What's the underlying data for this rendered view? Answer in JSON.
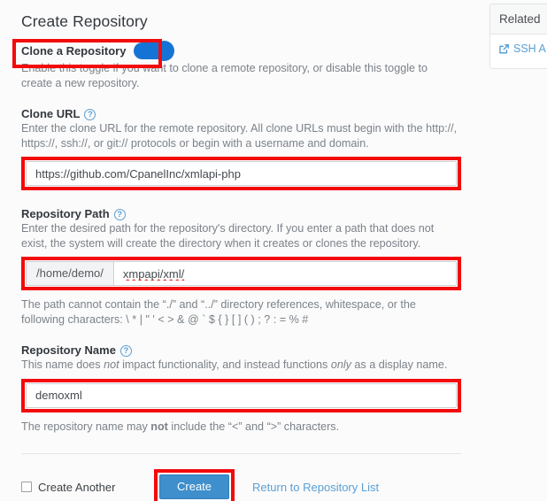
{
  "page_title": "Create Repository",
  "clone_toggle": {
    "label": "Clone a Repository",
    "state": "on",
    "help": "Enable this toggle if you want to clone a remote repository, or disable this toggle to create a new repository."
  },
  "clone_url": {
    "label": "Clone URL",
    "help_icon": "question-circle-icon",
    "help": "Enter the clone URL for the remote repository. All clone URLs must begin with the http://, https://, ssh://, or git:// protocols or begin with a username and domain.",
    "value": "https://github.com/CpanelInc/xmlapi-php",
    "placeholder": ""
  },
  "repository_path": {
    "label": "Repository Path",
    "help_icon": "question-circle-icon",
    "help": "Enter the desired path for the repository's directory. If you enter a path that does not exist, the system will create the directory when it creates or clones the repository.",
    "prefix": "/home/demo/",
    "value": "xmpapi/xml/",
    "placeholder": "",
    "note": "The path cannot contain the “./” and “../” directory references, whitespace, or the following characters: \\ * | \" ' < > & @ ` $ { } [ ] ( ) ; ? : = % #"
  },
  "repository_name": {
    "label": "Repository Name",
    "help_icon": "question-circle-icon",
    "help_parts": {
      "a": "This name does ",
      "b": "not",
      "c": " impact functionality, and instead functions ",
      "d": "only",
      "e": " as a display name."
    },
    "value": "demoxml",
    "placeholder": "",
    "note_parts": {
      "a": "The repository name may ",
      "b": "not",
      "c": " include the “<” and “>” characters."
    }
  },
  "footer": {
    "create_another_label": "Create Another",
    "create_another_checked": false,
    "create_button": "Create",
    "return_link": "Return to Repository List"
  },
  "related_panel": {
    "title": "Related",
    "link_label": "SSH A",
    "link_icon": "external-link-icon"
  },
  "colors": {
    "annotation": "#f30a0a",
    "toggle_on": "#1673d6",
    "primary_button": "#3e8fcc",
    "link": "#5a9fd4"
  }
}
